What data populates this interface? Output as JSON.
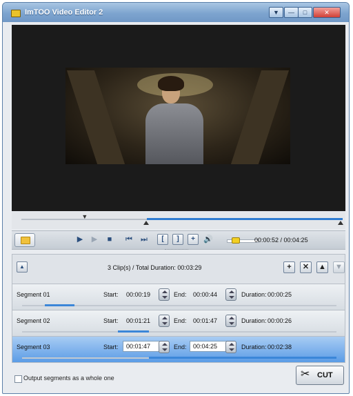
{
  "window": {
    "title": "ImTOO Video Editor 2",
    "buttons": {
      "menu": "▼",
      "minimize": "—",
      "maximize": "□",
      "close": "✕"
    }
  },
  "player": {
    "current_time": "00:00:52",
    "total_time": "00:04:25",
    "time_readout": "00:00:52 / 00:04:25",
    "progress": 0.196,
    "selection_start": 0.39,
    "selection_end": 1.0,
    "volume_level": 0.2,
    "icons": {
      "open": "folder-icon",
      "play": "play-icon",
      "step": "step-forward-icon",
      "stop": "stop-icon",
      "prev": "previous-icon",
      "next": "next-icon",
      "mark_in": "mark-in-icon",
      "mark_out": "mark-out-icon",
      "add": "add-icon",
      "volume": "volume-icon"
    }
  },
  "segments_header": {
    "summary": "3 Clip(s) / Total Duration: 00:03:29",
    "add_button": "+",
    "delete_button": "✕",
    "up_button": "▲",
    "down_button": "▼"
  },
  "segments": [
    {
      "name": "Segment 01",
      "start_label": "Start:",
      "start": "00:00:19",
      "end_label": "End:",
      "end": "00:00:44",
      "duration_label": "Duration:",
      "duration": "00:00:25",
      "selected": false
    },
    {
      "name": "Segment 02",
      "start_label": "Start:",
      "start": "00:01:21",
      "end_label": "End:",
      "end": "00:01:47",
      "duration_label": "Duration:",
      "duration": "00:00:26",
      "selected": false
    },
    {
      "name": "Segment 03",
      "start_label": "Start:",
      "start": "00:01:47",
      "end_label": "End:",
      "end": "00:04:25",
      "duration_label": "Duration:",
      "duration": "00:02:38",
      "selected": true
    }
  ],
  "footer": {
    "output_whole_label": "Output segments as a whole one",
    "output_whole_checked": false,
    "cut_label": "CUT"
  }
}
